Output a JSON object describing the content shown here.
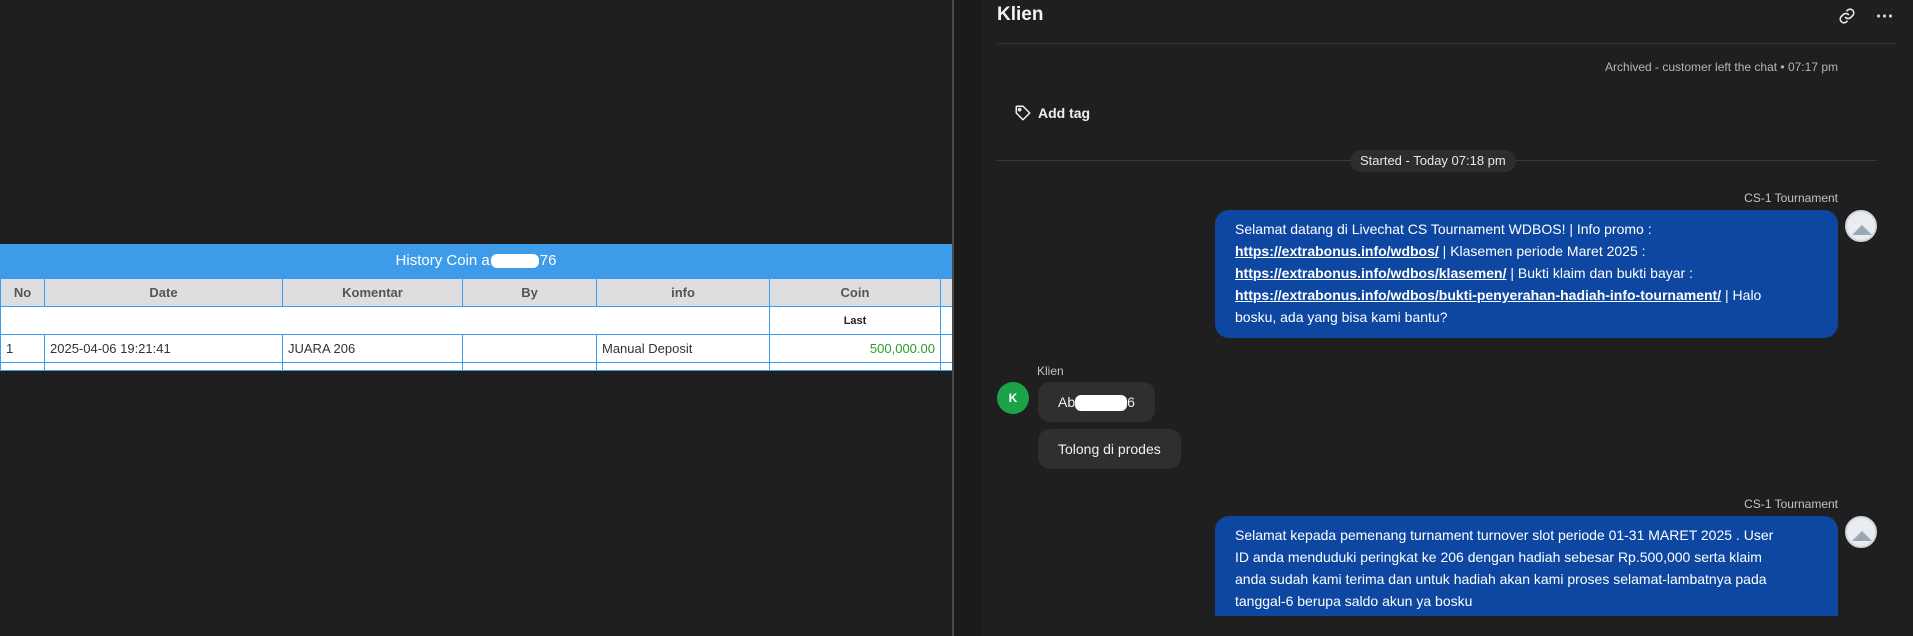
{
  "history": {
    "title_prefix": "History Coin a",
    "title_suffix": "76",
    "columns": [
      "No",
      "Date",
      "Komentar",
      "By",
      "info",
      "Coin"
    ],
    "subheader_last": "Last",
    "row": {
      "no": "1",
      "date": "2025-04-06 19:21:41",
      "komentar": "JUARA 206",
      "by": "",
      "info": "Manual Deposit",
      "coin": "500,000.00"
    }
  },
  "chat": {
    "title": "Klien",
    "icons": {
      "link": "link-icon",
      "more": "more-icon",
      "tag": "tag-icon"
    },
    "archived": "Archived - customer left the chat • 07:17 pm",
    "add_tag": "Add tag",
    "started": "Started - Today 07:18 pm",
    "agent_name": "CS-1 Tournament",
    "client_name": "Klien",
    "client_initial": "K",
    "msg1": {
      "part1": "Selamat datang di Livechat CS Tournament WDBOS! | Info promo :",
      "link1": "https://extrabonus.info/wdbos/",
      "part2": " | Klasemen periode Maret 2025 :",
      "link2": "https://extrabonus.info/wdbos/klasemen/",
      "part3": " | Bukti klaim dan bukti bayar :",
      "link3": "https://extrabonus.info/wdbos/bukti-penyerahan-hadiah-info-tournament/",
      "part4": " | Halo",
      "part5": "bosku, ada yang bisa kami bantu?"
    },
    "client_msg1_prefix": "Ab",
    "client_msg1_suffix": "6",
    "client_msg2": "Tolong di prodes",
    "msg2": {
      "line1": "Selamat kepada pemenang turnament turnover slot periode 01-31 MARET 2025 . User",
      "line2": "ID anda menduduki peringkat ke 206 dengan hadiah sebesar Rp.500,000 serta klaim",
      "line3": "anda sudah kami terima dan untuk hadiah akan kami proses selamat-lambatnya pada",
      "line4": "tanggal-6 berupa saldo akun ya bosku"
    },
    "colors": {
      "agent_bubble": "#0d47a1",
      "client_avatar": "#1ca34a",
      "table_header": "#3d9be9",
      "coin_value": "#2aa12a"
    }
  }
}
